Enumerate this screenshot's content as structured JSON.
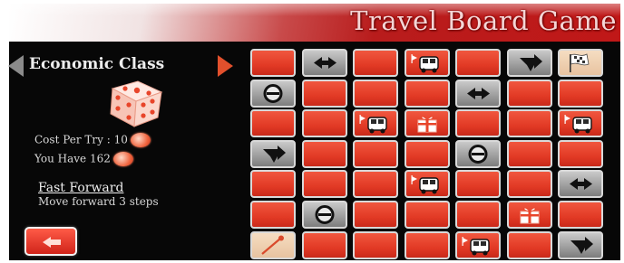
{
  "title": "Travel Board Game",
  "class_selector": {
    "label": "Economic Class",
    "prev_icon": "triangle-left-icon",
    "next_icon": "triangle-right-icon"
  },
  "dice": {
    "icon": "dice-icon"
  },
  "cost": {
    "text": "Cost Per Try : 10",
    "token_icon": "coin-token-icon"
  },
  "balance": {
    "text": "You Have 162",
    "token_icon": "coin-token-icon"
  },
  "power": {
    "name": "Fast Forward",
    "description": "Move forward 3 steps"
  },
  "back_button": {
    "icon": "back-arrow-icon"
  },
  "colors": {
    "tile_red": "#e23a25",
    "tile_grey": "#9c9c9c",
    "tile_tan": "#e8c3a0",
    "banner_red": "#c01818",
    "background": "#070707"
  },
  "board": {
    "columns": 7,
    "rows": 7,
    "cells": [
      [
        "red",
        "swap",
        "red",
        "bus",
        "red",
        "turn",
        "flag"
      ],
      [
        "block",
        "red",
        "red",
        "red",
        "swap",
        "red",
        "red"
      ],
      [
        "red",
        "red",
        "bus",
        "gift",
        "red",
        "red",
        "bus"
      ],
      [
        "turn",
        "red",
        "red",
        "red",
        "block",
        "red",
        "red"
      ],
      [
        "red",
        "red",
        "red",
        "bus",
        "red",
        "red",
        "swap"
      ],
      [
        "red",
        "block",
        "red",
        "red",
        "red",
        "gift",
        "red"
      ],
      [
        "pin",
        "red",
        "red",
        "red",
        "bus",
        "red",
        "turn"
      ]
    ]
  }
}
